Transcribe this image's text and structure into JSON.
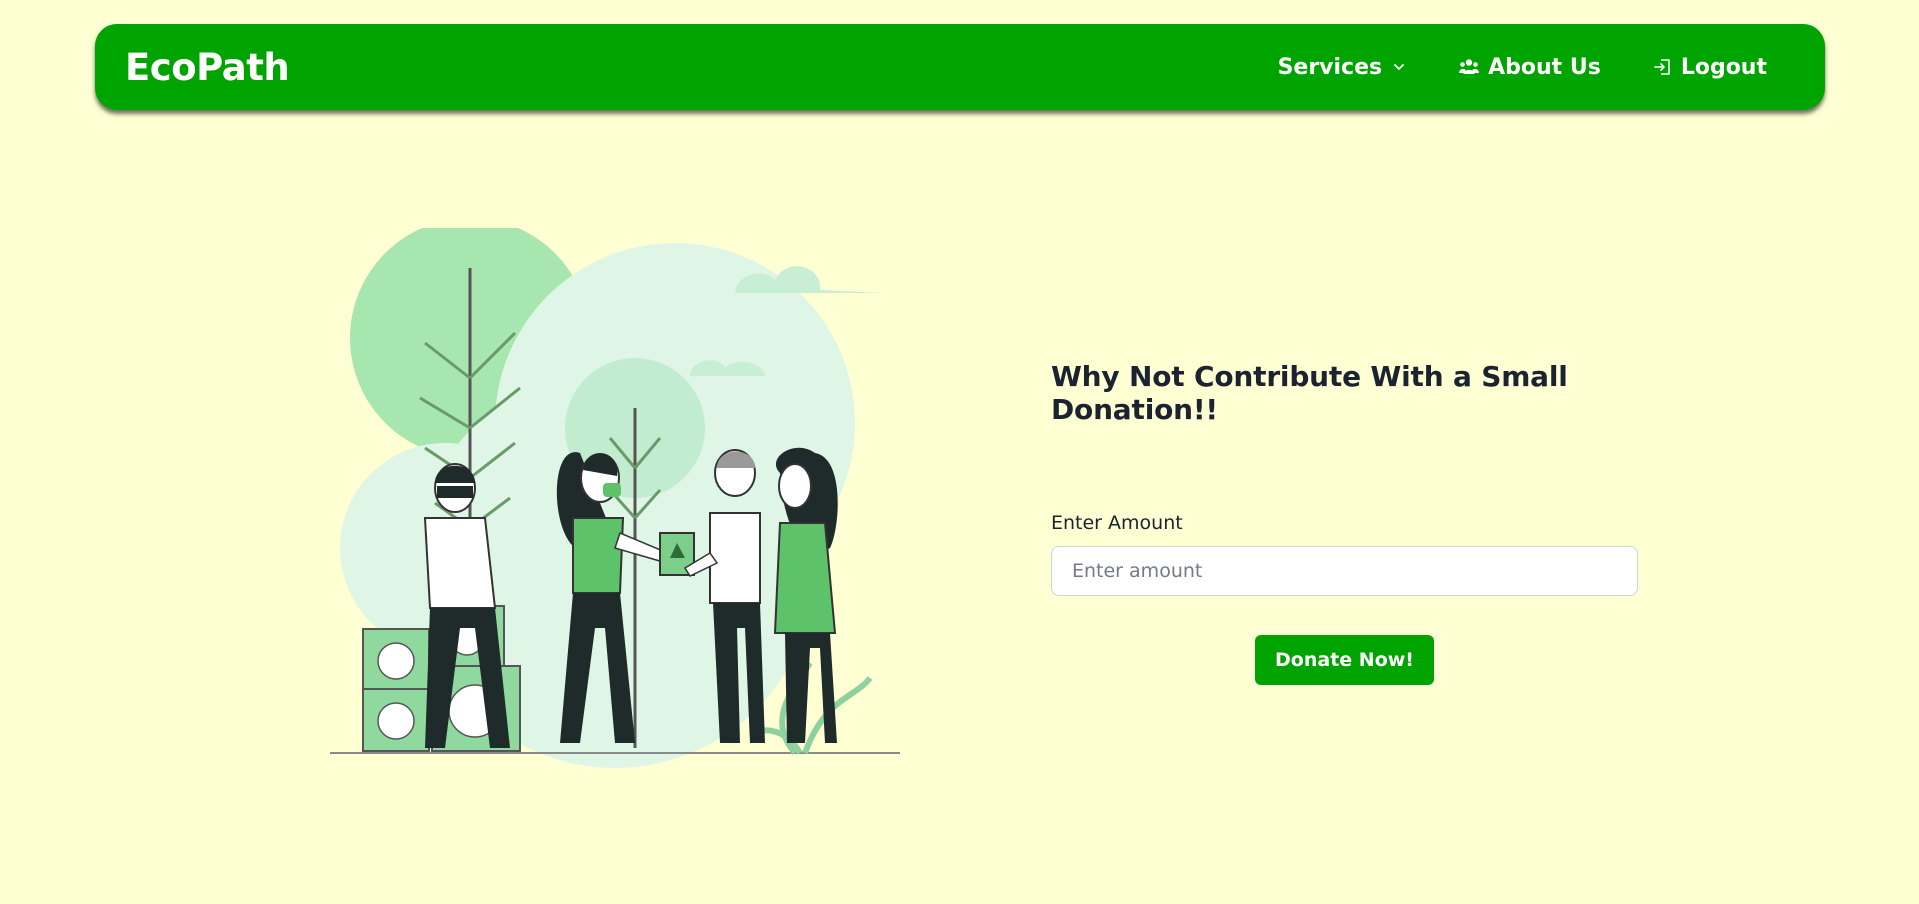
{
  "navbar": {
    "brand": "EcoPath",
    "items": [
      {
        "label": "Services",
        "icon": "chevron-down-icon"
      },
      {
        "label": "About Us",
        "icon": "users-icon"
      },
      {
        "label": "Logout",
        "icon": "logout-icon"
      }
    ],
    "color": "#00a400"
  },
  "donation": {
    "heading": "Why Not Contribute With a Small Donation!!",
    "amount_label": "Enter Amount",
    "amount_placeholder": "Enter amount",
    "amount_value": "",
    "button_label": "Donate Now!"
  },
  "theme": {
    "background": "#ffffd4",
    "accent": "#00a400"
  }
}
